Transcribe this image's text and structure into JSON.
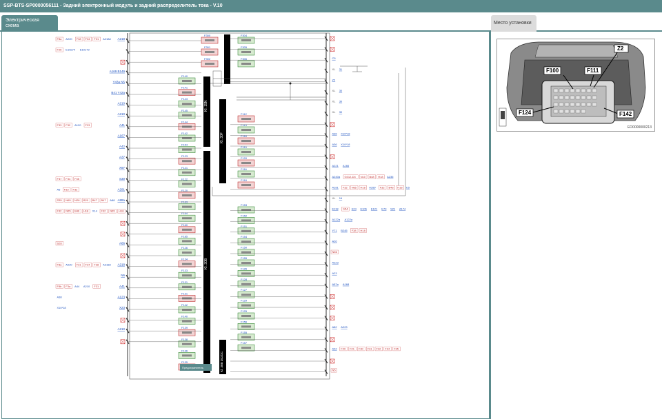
{
  "window": {
    "title": "SSP-BTS-SP0000056111 - Задний электронный модуль и задний распределитель тока - V.10"
  },
  "tabs": {
    "diagram": "Электрическая схема",
    "location": "Место установки"
  },
  "location_image": {
    "callouts": [
      "Z2",
      "F100",
      "F111",
      "F124",
      "F142"
    ],
    "image_id": "EO0000000213"
  },
  "diagram": {
    "bus_labels": [
      "Kl. 15N",
      "Kl. 30F",
      "Kl. 30B",
      "Kl. 30B DC/DC"
    ],
    "tooltip": "Предохранитель",
    "top_fuses_col1": [
      "F300",
      "F301",
      "F302"
    ],
    "top_fuses_col2": [
      "F304",
      "F305",
      "F306"
    ],
    "left_fuses": [
      "F140",
      "F141",
      "F143",
      "F145",
      "F144",
      "F142",
      "F154",
      "F123",
      "F121",
      "F122",
      "F120",
      "F163",
      "F164",
      "F160",
      "F185",
      "F126",
      "F134",
      "F133",
      "F131",
      "F131",
      "F142",
      "F140",
      "F139",
      "F138",
      "F136",
      "F135"
    ],
    "middle_fuses": [
      "F112",
      "F113",
      "F118",
      "F119",
      "F120",
      "F116",
      "F118"
    ],
    "lower_fuses": [
      "F153",
      "F152",
      "F151",
      "F154",
      "F150",
      "F155",
      "F126",
      "F128",
      "F127",
      "F129",
      "F125",
      "F156",
      "F155",
      "F157"
    ],
    "left_rows": [
      {
        "codes": [
          "F8a",
          "A220",
          "F38",
          "F34",
          "F31",
          "A218d"
        ],
        "end": "A218"
      },
      {
        "codes": [
          "F25",
          "E10a74",
          "E10179"
        ],
        "end": ""
      },
      {
        "codes": [],
        "end": "X"
      },
      {
        "codes": [],
        "end": "A169  B149"
      },
      {
        "codes": [],
        "end": "Y43a  N5"
      },
      {
        "codes": [],
        "end": "B41  Y42a"
      },
      {
        "codes": [],
        "end": "A210"
      },
      {
        "codes": [],
        "end": "A210"
      },
      {
        "codes": [
          "F33",
          "F32",
          "A120",
          "F23"
        ],
        "end": "A41"
      },
      {
        "codes": [],
        "end": "A167"
      },
      {
        "codes": [],
        "end": "A42"
      },
      {
        "codes": [],
        "end": "A37"
      },
      {
        "codes": [],
        "end": "X97"
      },
      {
        "codes": [
          "F37",
          "F34",
          "F35"
        ],
        "end": "S30"
      },
      {
        "codes": [
          "A5",
          "F33",
          "F32"
        ],
        "end": "A291"
      },
      {
        "codes": [
          "S35",
          "N65",
          "N28",
          "B20",
          "B47",
          "B47",
          "A88"
        ],
        "end": "A88a"
      },
      {
        "codes": [
          "F32",
          "N65",
          "B46",
          "H18",
          "X14",
          "F32",
          "N65",
          "H18"
        ],
        "end": "B72"
      },
      {
        "codes": [],
        "end": "X"
      },
      {
        "codes": [],
        "end": "X"
      },
      {
        "codes": [
          "S28"
        ],
        "end": "A66"
      },
      {
        "codes": [],
        "end": "X"
      },
      {
        "codes": [
          "F8a",
          "A220",
          "F31",
          "F24",
          "F38",
          "A218d"
        ],
        "end": "A218"
      },
      {
        "codes": [],
        "end": "N6"
      },
      {
        "codes": [
          "F8b",
          "F3a",
          "A44",
          "A210",
          "F31"
        ],
        "end": "A41"
      },
      {
        "codes": [
          "A38"
        ],
        "end": "A123"
      },
      {
        "codes": [
          "X10*18"
        ],
        "end": "X23"
      },
      {
        "codes": [],
        "end": "X"
      },
      {
        "codes": [],
        "end": "A210"
      },
      {
        "codes": [],
        "end": "X"
      }
    ],
    "right_rows": [
      "X",
      "X",
      "C5",
      "XL 31",
      "Z2",
      "XL 30",
      "XL 30",
      "XL 30",
      "X",
      "A36  X10*18",
      "A36  X10*18",
      "X",
      "A221  A166",
      "A240a  G012-D4  N10  B48  H18  A236",
      "A181  F32  N65  H18  A289  F32  B48  H18  E5",
      "XL 16",
      "E118  G5A  E24  E106  E121  E73  S21  A174",
      "A122a  A122a",
      "Y71  B245  F38  H18",
      "A26",
      "N66",
      "A223",
      "A23",
      "A57a  A168",
      "X",
      "X",
      "X",
      "A82  A223",
      "X",
      "A42  F20  F21  F30  F31  F32  F34  F35",
      "X",
      "N5"
    ]
  }
}
